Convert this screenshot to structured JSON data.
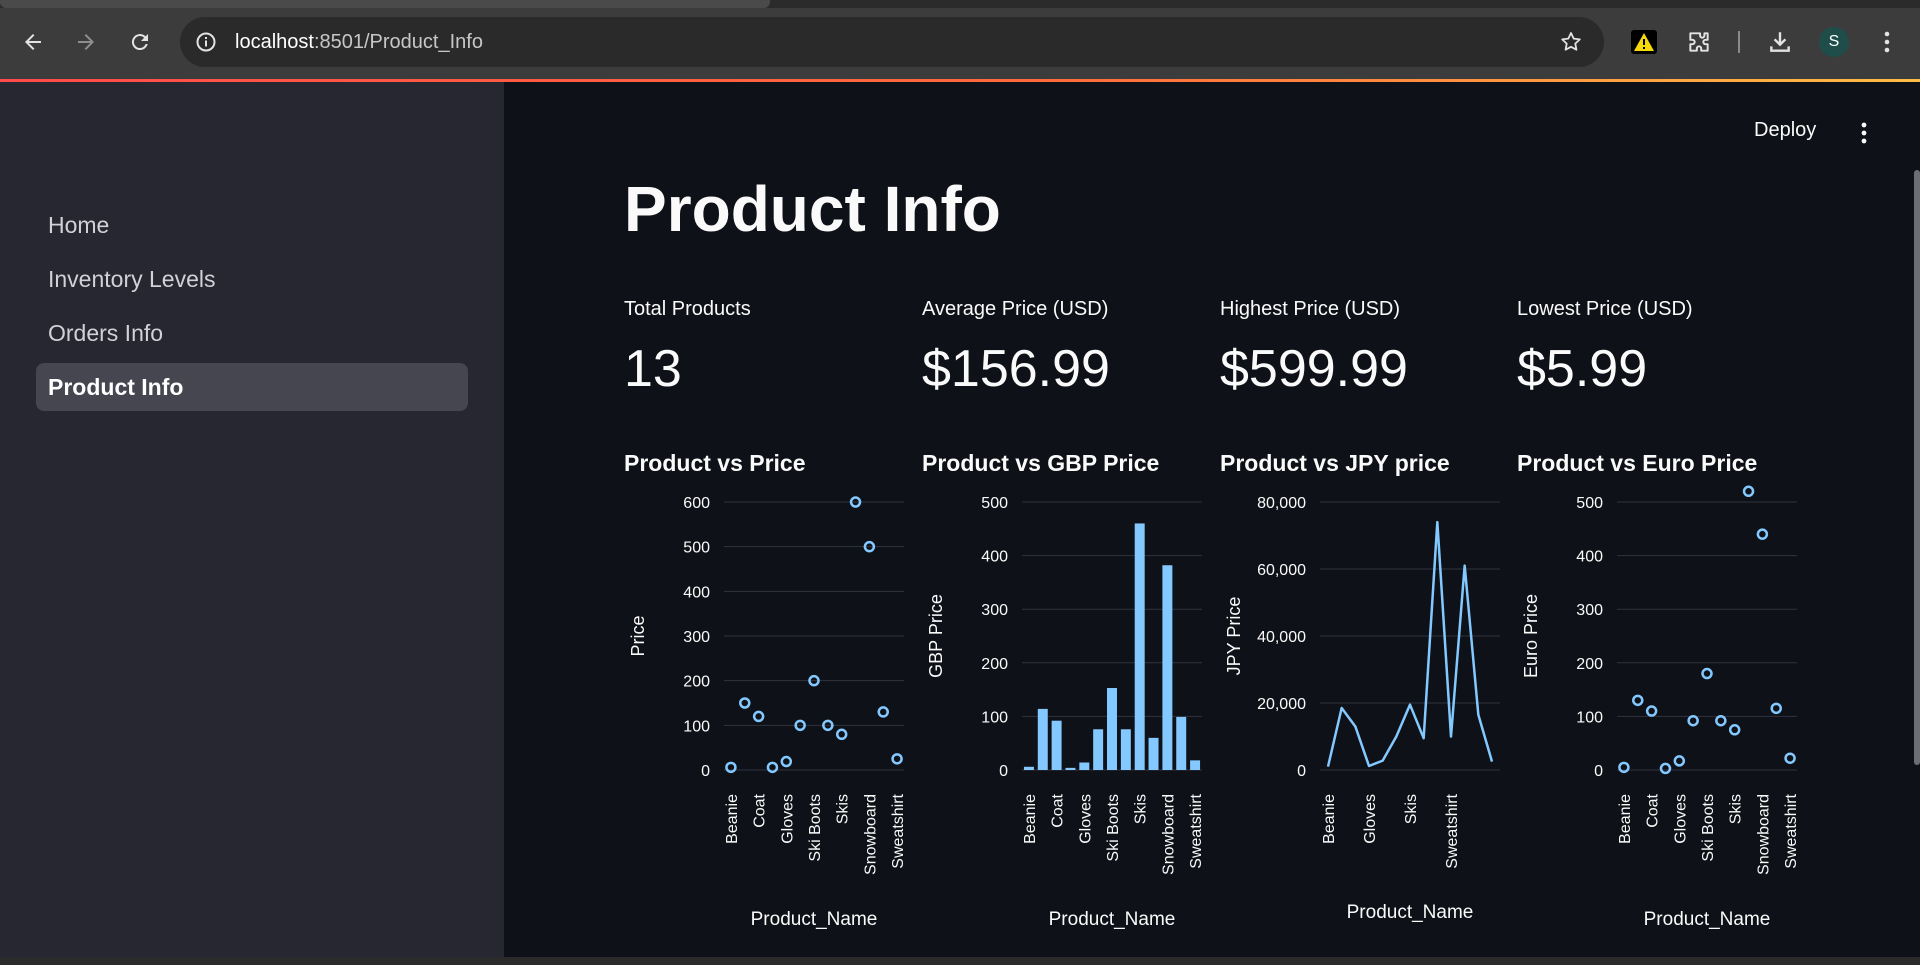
{
  "browser": {
    "url_host": "localhost",
    "url_path": ":8501/Product_Info",
    "profile_initial": "S",
    "icons": [
      "back-arrow-icon",
      "forward-arrow-icon",
      "reload-icon",
      "site-info-icon",
      "bookmark-star-icon",
      "warning-extension-icon",
      "puzzle-extensions-icon",
      "download-icon",
      "kebab-menu-icon"
    ]
  },
  "sidebar": {
    "items": [
      {
        "label": "Home"
      },
      {
        "label": "Inventory Levels"
      },
      {
        "label": "Orders Info"
      },
      {
        "label": "Product Info",
        "active": true
      }
    ]
  },
  "header": {
    "deploy_label": "Deploy"
  },
  "page": {
    "title": "Product Info"
  },
  "metrics": [
    {
      "label": "Total Products",
      "value": "13"
    },
    {
      "label": "Average Price (USD)",
      "value": "$156.99"
    },
    {
      "label": "Highest Price (USD)",
      "value": "$599.99"
    },
    {
      "label": "Lowest Price (USD)",
      "value": "$5.99"
    }
  ],
  "colors": {
    "accent": "#83c9ff",
    "grid": "#31333f",
    "sidebar_bg": "#262730",
    "main_bg": "#0e1117"
  },
  "chart_data": [
    {
      "type": "scatter",
      "title": "Product vs Price",
      "xlabel": "Product_Name",
      "ylabel": "Price",
      "ylim": [
        0,
        600
      ],
      "yticks": [
        0,
        100,
        200,
        300,
        400,
        500,
        600
      ],
      "ytick_labels": [
        "0",
        "100",
        "200",
        "300",
        "400",
        "500",
        "600"
      ],
      "xtick_labels": [
        "Beanie",
        "Coat",
        "Gloves",
        "Ski Boots",
        "Skis",
        "Snowboard",
        "Sweatshirt"
      ],
      "xtick_positions": [
        0,
        2,
        4,
        6,
        8,
        10,
        12
      ],
      "values": [
        6,
        150,
        120,
        5.99,
        19,
        100,
        200,
        100,
        80,
        599.99,
        500,
        130,
        25
      ],
      "grid": true
    },
    {
      "type": "bar",
      "title": "Product vs GBP Price",
      "xlabel": "Product_Name",
      "ylabel": "GBP Price",
      "ylim": [
        0,
        500
      ],
      "yticks": [
        0,
        100,
        200,
        300,
        400,
        500
      ],
      "ytick_labels": [
        "0",
        "100",
        "200",
        "300",
        "400",
        "500"
      ],
      "xtick_labels": [
        "Beanie",
        "Coat",
        "Gloves",
        "Ski Boots",
        "Skis",
        "Snowboard",
        "Sweatshirt"
      ],
      "xtick_positions": [
        0,
        2,
        4,
        6,
        8,
        10,
        12
      ],
      "values": [
        6,
        114,
        92,
        4,
        14,
        76,
        153,
        76,
        460,
        60,
        382,
        99,
        18
      ],
      "grid": true
    },
    {
      "type": "line",
      "title": "Product vs JPY price",
      "xlabel": "Product_Name",
      "ylabel": "JPY Price",
      "ylim": [
        0,
        80000
      ],
      "yticks": [
        0,
        20000,
        40000,
        60000,
        80000
      ],
      "ytick_labels": [
        "0",
        "20,000",
        "40,000",
        "60,000",
        "80,000"
      ],
      "xtick_labels": [
        "Beanie",
        "Gloves",
        "Skis",
        "Sweatshirt"
      ],
      "xtick_positions": [
        0,
        3,
        6,
        9
      ],
      "values": [
        1000,
        18500,
        13000,
        1200,
        2800,
        10000,
        19500,
        9500,
        74000,
        10000,
        61000,
        16500,
        2500
      ],
      "grid": true
    },
    {
      "type": "scatter",
      "title": "Product vs Euro Price",
      "xlabel": "Product_Name",
      "ylabel": "Euro Price",
      "ylim": [
        0,
        500
      ],
      "yticks": [
        0,
        100,
        200,
        300,
        400,
        500
      ],
      "ytick_labels": [
        "0",
        "100",
        "200",
        "300",
        "400",
        "500"
      ],
      "xtick_labels": [
        "Beanie",
        "Coat",
        "Gloves",
        "Ski Boots",
        "Skis",
        "Snowboard",
        "Sweatshirt"
      ],
      "xtick_positions": [
        0,
        2,
        4,
        6,
        8,
        10,
        12
      ],
      "values": [
        5,
        130,
        110,
        3,
        17,
        92,
        180,
        92,
        75,
        520,
        440,
        115,
        22
      ],
      "grid": true
    }
  ]
}
